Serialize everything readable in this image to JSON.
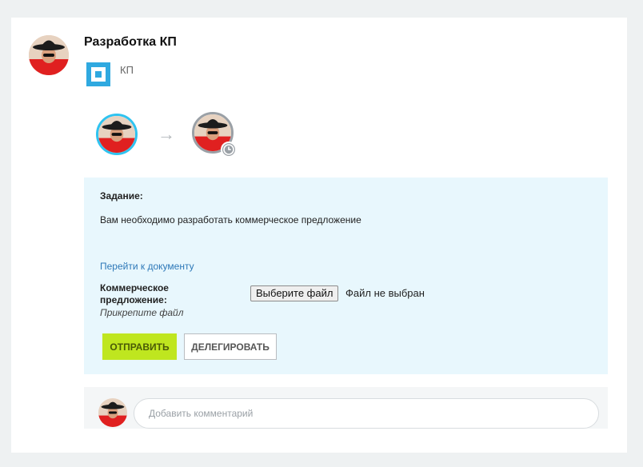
{
  "task": {
    "title": "Разработка КП",
    "app_label": "КП",
    "section_label": "Задание:",
    "description": "Вам необходимо разработать коммерческое предложение",
    "doc_link": "Перейти к документу",
    "field_label": "Коммерческое предложение:",
    "field_hint": "Прикрепите файл",
    "file_button": "Выберите файл",
    "file_status": "Файл не выбран",
    "send_button": "ОТПРАВИТЬ",
    "delegate_button": "ДЕЛЕГИРОВАТЬ"
  },
  "comment": {
    "placeholder": "Добавить комментарий"
  },
  "icons": {
    "app": "app-square-icon",
    "arrow": "arrow-right-icon",
    "status": "clock-icon"
  },
  "colors": {
    "accent_blue": "#2fa9e0",
    "task_bg": "#e8f7fd",
    "send_button": "#bfe61f",
    "active_ring": "#2fc3f0"
  }
}
